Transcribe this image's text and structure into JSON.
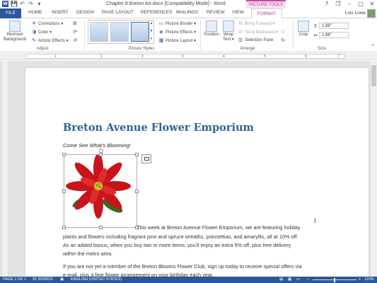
{
  "app": {
    "title": "Chapter 8 Breton Art.docx [Compatibility Mode] - Word",
    "contextual_tab_group": "PICTURE TOOLS",
    "window_controls": [
      "?",
      "❐",
      "–",
      "□",
      "✕"
    ],
    "user": "Lois Lowe"
  },
  "qat": {
    "save_icon": "💾",
    "undo_icon": "↶",
    "redo_icon": "↷",
    "customize_icon": "▾"
  },
  "tabs": {
    "file": "FILE",
    "home": "HOME",
    "insert": "INSERT",
    "design": "DESIGN",
    "page_layout": "PAGE LAYOUT",
    "references": "REFERENCES",
    "mailings": "MAILINGS",
    "review": "REVIEW",
    "view": "VIEW",
    "format": "FORMAT"
  },
  "ribbon": {
    "remove_background": "Remove Background",
    "corrections": "Corrections ▾",
    "color": "Color ▾",
    "artistic_effects": "Artistic Effects ▾",
    "adjust_label": "Adjust",
    "picture_styles_label": "Picture Styles",
    "picture_border": "Picture Border ▾",
    "picture_effects": "Picture Effects ▾",
    "picture_layout": "Picture Layout ▾",
    "position": "Position",
    "wrap_text": "Wrap Text ▾",
    "bring_forward": "Bring Forward ▾",
    "send_backward": "Send Backward ▾",
    "selection_pane": "Selection Pane",
    "arrange_label": "Arrange",
    "crop": "Crop",
    "height": "1.88\"",
    "width": "1.88\"",
    "size_label": "Size"
  },
  "ruler": {
    "numbers": [
      "1",
      "1",
      "2",
      "3",
      "4",
      "5",
      "6",
      "7"
    ]
  },
  "document": {
    "heading": "Breton Avenue Flower Emporium",
    "subtitle": "Come See What’s Blooming!",
    "para1_line1": "This week at Breton Avenue Flower Emporium, we are featuring holiday",
    "para1_line2": "plants and flowers including fragrant pine and spruce wreaths, poinsettias, and amaryllis, all at 10% off.",
    "para1_line3": "As an added bonus, when you buy two or more items, you’ll enjoy an extra 5% off, plus free delivery",
    "para1_line4": "within the metro area.",
    "para2_line1": "If you are not yet a member of the Breton Blooms Flower Club, sign up today to receive special offers via",
    "para2_line2": "e-mail, plus a free flower arrangement on your birthday each year."
  },
  "statusbar": {
    "page": "PAGE 1 OF 1",
    "words": "91 WORDS",
    "language": "ENGLISH (UNITED STATES)",
    "zoom": "110%"
  },
  "colors": {
    "accent": "#2b579a",
    "contextual": "#b83b8f",
    "heading": "#2e6399"
  }
}
